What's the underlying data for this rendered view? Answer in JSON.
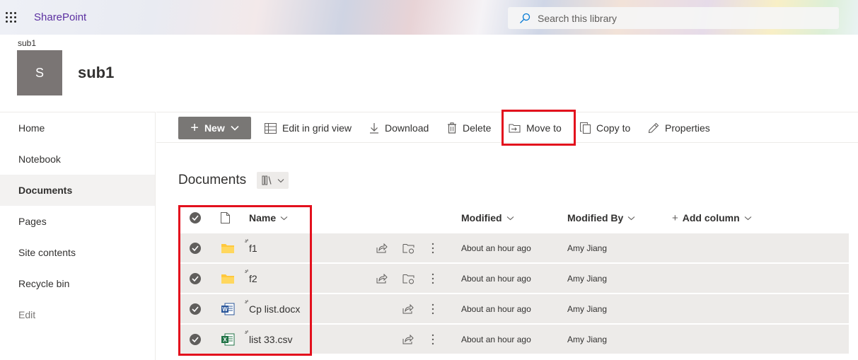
{
  "suitebar": {
    "brand": "SharePoint",
    "search_placeholder": "Search this library"
  },
  "site": {
    "breadcrumb": "sub1",
    "logo_letter": "S",
    "title": "sub1"
  },
  "nav": {
    "items": [
      {
        "label": "Home"
      },
      {
        "label": "Notebook"
      },
      {
        "label": "Documents"
      },
      {
        "label": "Pages"
      },
      {
        "label": "Site contents"
      },
      {
        "label": "Recycle bin"
      },
      {
        "label": "Edit"
      }
    ],
    "selected": "Documents"
  },
  "commandbar": {
    "new_label": "New",
    "edit_grid_label": "Edit in grid view",
    "download_label": "Download",
    "delete_label": "Delete",
    "move_to_label": "Move to",
    "copy_to_label": "Copy to",
    "properties_label": "Properties"
  },
  "library": {
    "title": "Documents",
    "columns": {
      "name": "Name",
      "modified": "Modified",
      "modified_by": "Modified By",
      "add_column": "Add column"
    },
    "rows": [
      {
        "name": "f1",
        "type": "folder",
        "modified": "About an hour ago",
        "modified_by": "Amy Jiang"
      },
      {
        "name": "f2",
        "type": "folder",
        "modified": "About an hour ago",
        "modified_by": "Amy Jiang"
      },
      {
        "name": "Cp list.docx",
        "type": "word",
        "modified": "About an hour ago",
        "modified_by": "Amy Jiang"
      },
      {
        "name": "list 33.csv",
        "type": "excel",
        "modified": "About an hour ago",
        "modified_by": "Amy Jiang"
      }
    ]
  },
  "colors": {
    "accent": "#5b2fa0",
    "highlight": "#e3101d",
    "folder": "#ffc83d",
    "word": "#2b579a",
    "excel": "#217346"
  }
}
